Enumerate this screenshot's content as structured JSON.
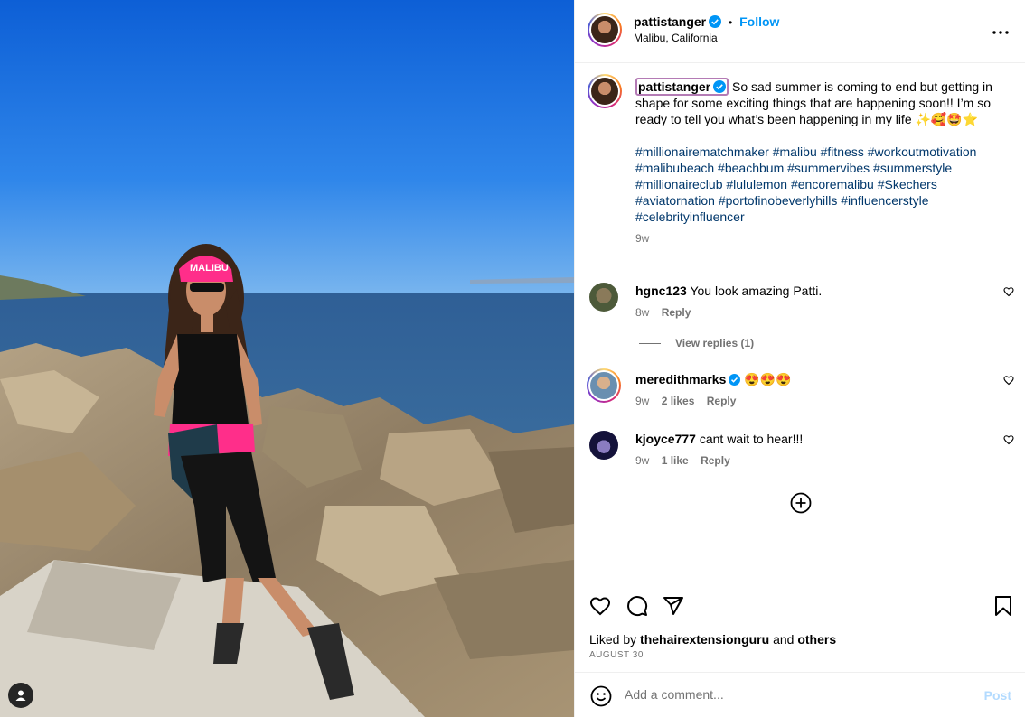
{
  "post": {
    "author": "pattistanger",
    "follow_label": "Follow",
    "separator": "•",
    "location": "Malibu, California"
  },
  "caption": {
    "text": "So sad summer is coming to end but getting in shape for some exciting things that are happening soon!! I’m so ready to tell you what’s been happening in my life ✨🥰🤩⭐",
    "hashtags": "#millionairematchmaker #malibu #fitness #workoutmotivation #malibubeach #beachbum #summervibes #summerstyle #millionaireclub #lululemon #encoremalibu #Skechers #aviatornation #portofinobeverlyhills #influencerstyle #celebrityinfluencer",
    "time": "9w"
  },
  "comments": [
    {
      "user": "hgnc123",
      "text": "You look amazing Patti.",
      "time": "8w",
      "likes": "",
      "reply": "Reply"
    },
    {
      "user": "meredithmarks",
      "text": "😍😍😍",
      "time": "9w",
      "likes": "2 likes",
      "reply": "Reply"
    },
    {
      "user": "kjoyce777",
      "text": "cant wait to hear!!!",
      "time": "9w",
      "likes": "1 like",
      "reply": "Reply"
    }
  ],
  "view_replies": "View replies (1)",
  "likes": {
    "prefix": "Liked by",
    "user": "thehairextensionguru",
    "and": "and",
    "others": "others"
  },
  "date": "AUGUST 30",
  "composer": {
    "placeholder": "Add a comment...",
    "post_label": "Post"
  },
  "photo": {
    "cap_text": "MALIBU"
  },
  "colors": {
    "accent": "#0095f6",
    "hashtag": "#00376b",
    "muted": "#737373",
    "post_disabled": "#b3dbff"
  }
}
